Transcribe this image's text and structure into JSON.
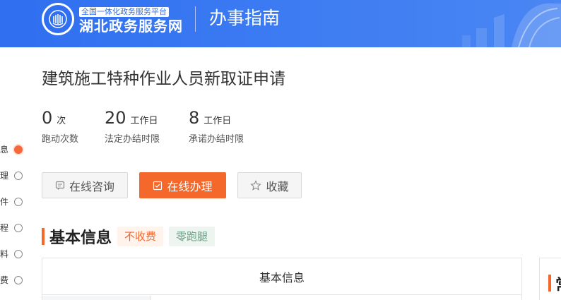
{
  "header": {
    "portal_tagline": "全国一体化政务服务平台",
    "portal_name": "湖北政务服务网",
    "section_title": "办事指南"
  },
  "side_nav": {
    "items": [
      {
        "label": "息",
        "active": true
      },
      {
        "label": "理",
        "active": false
      },
      {
        "label": "件",
        "active": false
      },
      {
        "label": "程",
        "active": false
      },
      {
        "label": "料",
        "active": false
      },
      {
        "label": "费",
        "active": false
      }
    ]
  },
  "page_title": "建筑施工特种作业人员新取证申请",
  "stats": [
    {
      "value": "0",
      "unit": "次",
      "caption": "跑动次数"
    },
    {
      "value": "20",
      "unit": "工作日",
      "caption": "法定办结时限"
    },
    {
      "value": "8",
      "unit": "工作日",
      "caption": "承诺办结时限"
    }
  ],
  "actions": {
    "consult_label": "在线咨询",
    "handle_label": "在线办理",
    "favorite_label": "收藏"
  },
  "basic_info": {
    "title": "基本信息",
    "tag_fee": "不收费",
    "tag_zero_run": "零跑腿",
    "table_header": "基本信息"
  },
  "right_panel": {
    "title_fragment": "常"
  },
  "colors": {
    "header_blue": "#2f6ff0",
    "accent_orange": "#f5682c",
    "tag_green": "#6aa287"
  }
}
